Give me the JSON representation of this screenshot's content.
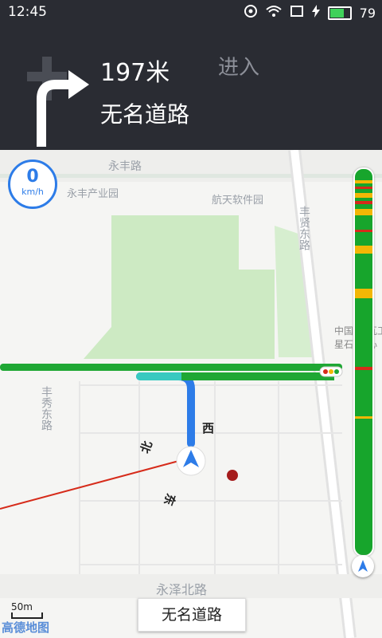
{
  "status_bar": {
    "time": "12:45",
    "battery_level": "79",
    "battery_fraction": 0.79
  },
  "guidance": {
    "distance": "197米",
    "action": "进入",
    "road_name": "无名道路",
    "turn": "right"
  },
  "speed": {
    "value": "0",
    "unit": "km/h"
  },
  "map_labels": {
    "road_north": "永丰路",
    "poi_yongfeng_park": "永丰产业园",
    "poi_aerospace_software": "航天软件园",
    "road_yongfeng_xian": "丰贤东路",
    "road_fengxiu": "丰秀东路",
    "road_yongze": "永泽北路",
    "poi_china_partial": "中国\n星石",
    "poi_right_partial": "瓦工\n心",
    "compass_west": "西",
    "compass_north": "北",
    "compass_east": "东"
  },
  "bottom": {
    "road_button": "无名道路",
    "scale": "50m",
    "logo": "高德地图"
  },
  "traffic_bar": {
    "colors": {
      "clear": "#17a52c",
      "slow": "#f2b705",
      "jam": "#d62b1a"
    }
  }
}
